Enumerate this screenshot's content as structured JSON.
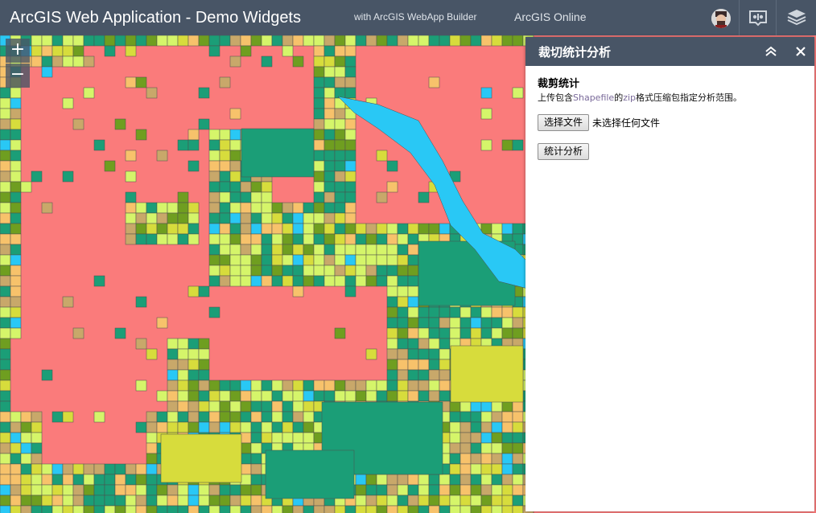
{
  "header": {
    "title": "ArcGIS Web Application - Demo Widgets",
    "subtitle": "with ArcGIS WebApp Builder",
    "portal_link": "ArcGIS Online",
    "icons": [
      "user-avatar",
      "tools-icon",
      "layers-icon"
    ]
  },
  "zoom": {
    "in_label": "+",
    "out_label": "−"
  },
  "panel": {
    "title": "裁切统计分析",
    "section_title": "裁剪统计",
    "description_prefix": "上传包含",
    "description_highlight1": "Shapefile",
    "description_mid": "的",
    "description_highlight2": "zip",
    "description_suffix": "格式压缩包指定分析范围。",
    "choose_file_label": "选择文件",
    "no_file_text": "未选择任何文件",
    "analyze_label": "统计分析"
  },
  "colors": {
    "header_bg": "#485566",
    "map_salmon": "#fa7b7b",
    "map_green": "#1b9e77",
    "map_yellow": "#d7dc3c",
    "map_lightyellow": "#d5f56a",
    "map_orange": "#f7c26b",
    "map_tan": "#c8a86a",
    "map_cyan": "#29c8f5",
    "map_olive": "#6f9e20"
  }
}
